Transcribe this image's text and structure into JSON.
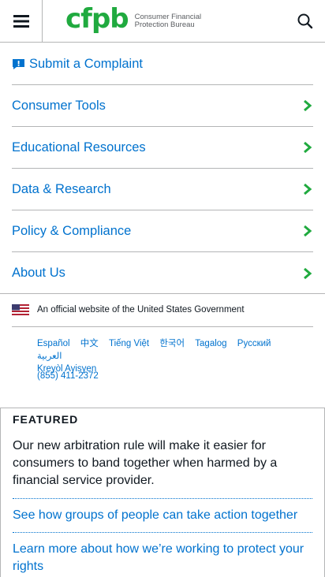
{
  "header": {
    "logo_mark": "cfpb",
    "logo_line1": "Consumer Financial",
    "logo_line2": "Protection Bureau"
  },
  "nav": {
    "complaint": "Submit a Complaint",
    "items": [
      {
        "label": "Consumer Tools"
      },
      {
        "label": "Educational Resources"
      },
      {
        "label": "Data & Research"
      },
      {
        "label": "Policy & Compliance"
      },
      {
        "label": "About Us"
      }
    ]
  },
  "gov": {
    "official_text": "An official website of the United States Government",
    "languages": [
      "Español",
      "中文",
      "Tiếng Việt",
      "한국어",
      "Tagalog",
      "Русский",
      "العربية",
      "Kreyòl Ayisyen"
    ],
    "phone": "(855) 411-2372"
  },
  "featured": {
    "heading": "FEATURED",
    "body": "Our new arbitration rule will make it easier for consumers to band together when harmed by a financial service provider.",
    "links": [
      "See how groups of people can take action together",
      "Learn more about how we’re working to protect your rights"
    ]
  },
  "colors": {
    "link": "#0072ce",
    "brand_green": "#20aa3f",
    "divider": "#b4b5b6"
  },
  "icons": [
    "menu-icon",
    "search-icon",
    "alert-icon",
    "chevron-right-icon",
    "us-flag-icon"
  ]
}
